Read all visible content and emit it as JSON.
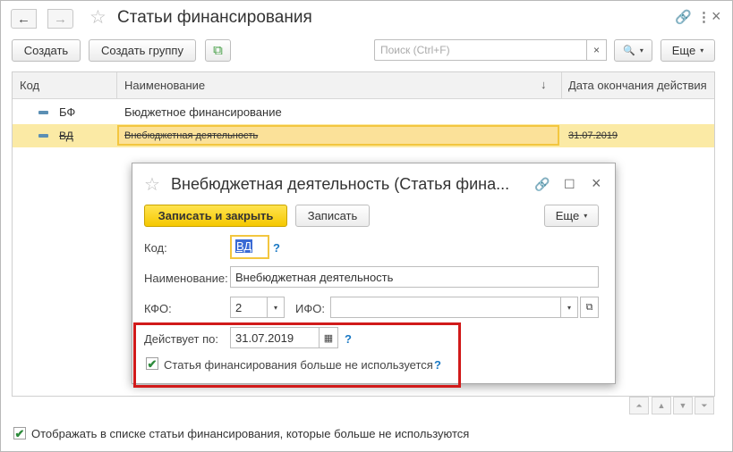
{
  "window": {
    "title": "Статьи финансирования",
    "nav_back_icon": "←",
    "nav_forward_icon": "→",
    "star_icon": "☆",
    "link_icon": "🔗",
    "more_icon": "⋮",
    "close_icon": "×"
  },
  "toolbar": {
    "create_label": "Создать",
    "create_group_label": "Создать группу",
    "copy_icon": "⧉",
    "search_placeholder": "Поиск (Ctrl+F)",
    "search_clear": "×",
    "search_icon": "🔍",
    "dropdown_caret": "▾",
    "more_label": "Еще"
  },
  "table": {
    "columns": [
      "Код",
      "Наименование",
      "Дата окончания действия"
    ],
    "sort_icon": "↓",
    "rows": [
      {
        "code": "БФ",
        "name": "Бюджетное финансирование",
        "end_date": ""
      },
      {
        "code": "ВД",
        "name": "Внебюджетная деятельность",
        "end_date": "31.07.2019"
      }
    ],
    "scroll_icons": [
      "⏶",
      "▲",
      "▼",
      "⏷"
    ]
  },
  "bottom": {
    "checkbox_checked": true,
    "check_mark": "✔",
    "label": "Отображать в списке статьи финансирования, которые больше не используются"
  },
  "dialog": {
    "title": "Внебюджетная деятельность (Статья фина...",
    "star_icon": "☆",
    "link_icon": "🔗",
    "maximize_icon": "☐",
    "close_icon": "×",
    "save_close_label": "Записать и закрыть",
    "save_label": "Записать",
    "more_label": "Еще",
    "dropdown_caret": "▾",
    "help_mark": "?",
    "code_label": "Код:",
    "code_value": "ВД",
    "name_label": "Наименование:",
    "name_value": "Внебюджетная деятельность",
    "kfo_label": "КФО:",
    "kfo_value": "2",
    "ifo_label": "ИФО:",
    "ifo_value": "",
    "open_icon": "⧉",
    "valid_label": "Действует по:",
    "valid_value": "31.07.2019",
    "calendar_icon": "▦",
    "unused_checked": true,
    "check_mark": "✔",
    "unused_label": "Статья финансирования больше не используется"
  },
  "colors": {
    "accent_yellow": "#f5c800",
    "selected_row": "#fbeaa5",
    "highlight_red": "#d11a1a",
    "help_blue": "#1b79c4",
    "check_green": "#2e8b3c"
  }
}
